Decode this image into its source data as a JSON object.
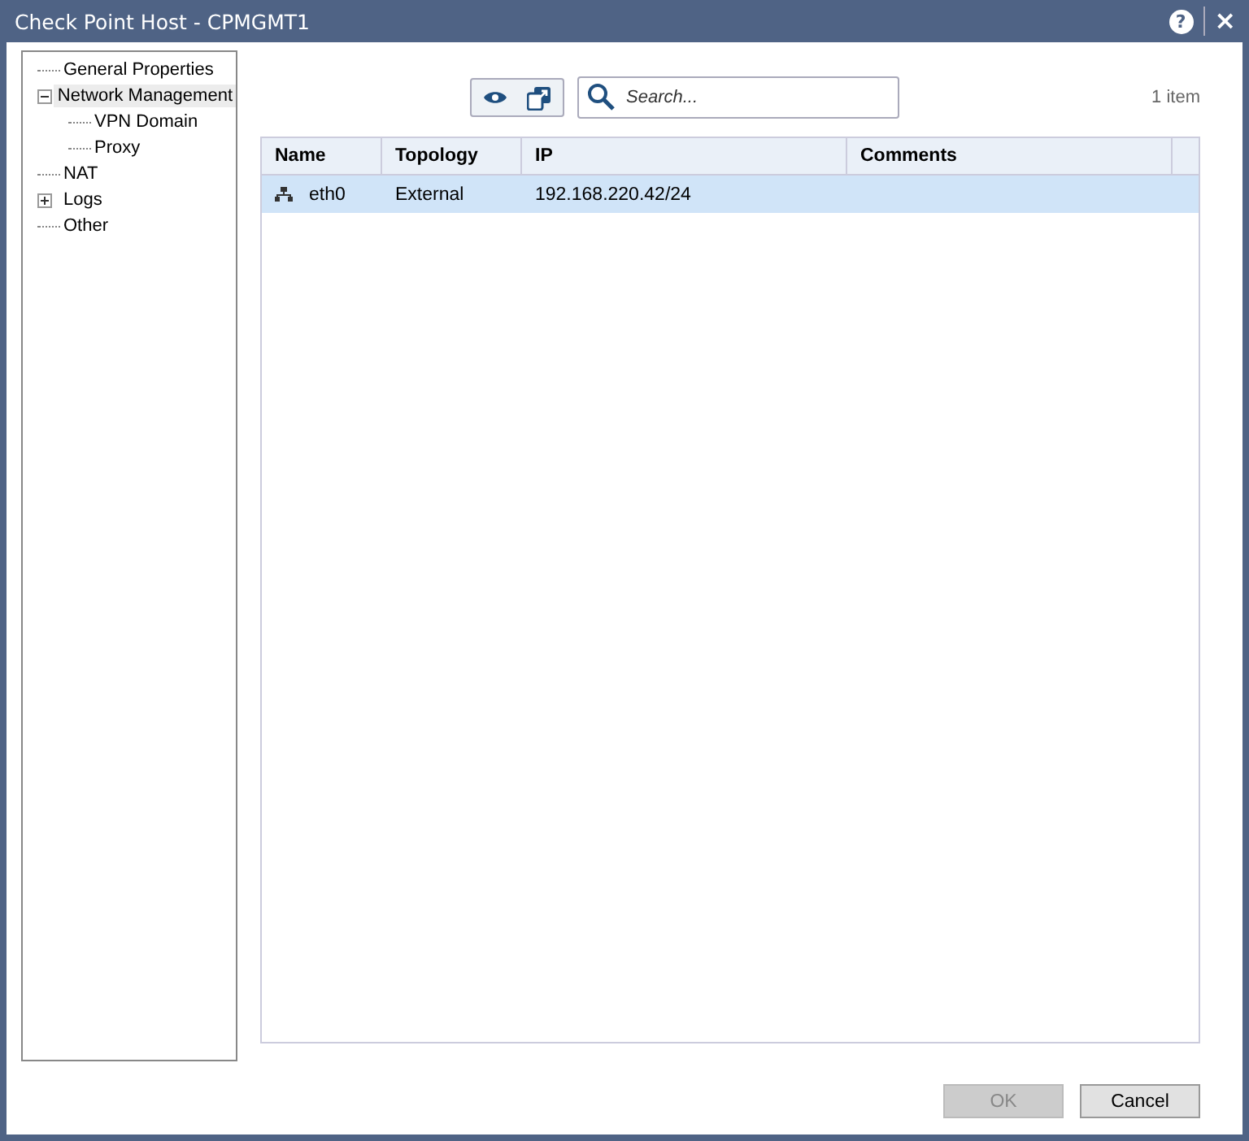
{
  "window": {
    "title": "Check Point Host - CPMGMT1",
    "help_icon": "?",
    "close_icon": "×"
  },
  "tree": [
    {
      "label": "General Properties",
      "selected": false
    },
    {
      "label": "Network Management",
      "selected": true,
      "expanded": true,
      "children": [
        {
          "label": "VPN Domain",
          "selected": false
        },
        {
          "label": "Proxy",
          "selected": false
        }
      ]
    },
    {
      "label": "NAT",
      "selected": false
    },
    {
      "label": "Logs",
      "selected": false,
      "expanded": false
    },
    {
      "label": "Other",
      "selected": false
    }
  ],
  "search": {
    "placeholder": "Search..."
  },
  "item_count": "1 item",
  "table": {
    "columns": [
      "Name",
      "Topology",
      "IP",
      "Comments"
    ],
    "rows": [
      {
        "cells": [
          "eth0",
          "External",
          "192.168.220.42/24",
          ""
        ],
        "selected": true
      }
    ]
  },
  "buttons": [
    {
      "label": "OK",
      "disabled": true
    },
    {
      "label": "Cancel",
      "disabled": false
    }
  ]
}
